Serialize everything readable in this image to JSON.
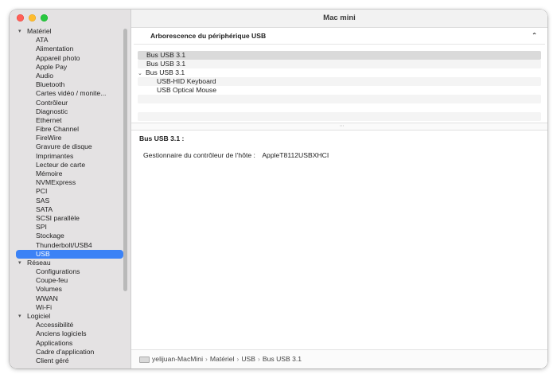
{
  "window": {
    "title": "Mac mini"
  },
  "sidebar": {
    "categories": [
      {
        "label": "Matériel",
        "items": [
          "ATA",
          "Alimentation",
          "Appareil photo",
          "Apple Pay",
          "Audio",
          "Bluetooth",
          "Cartes vidéo / monite...",
          "Contrôleur",
          "Diagnostic",
          "Ethernet",
          "Fibre Channel",
          "FireWire",
          "Gravure de disque",
          "Imprimantes",
          "Lecteur de carte",
          "Mémoire",
          "NVMExpress",
          "PCI",
          "SAS",
          "SATA",
          "SCSI parallèle",
          "SPI",
          "Stockage",
          "Thunderbolt/USB4",
          "USB"
        ]
      },
      {
        "label": "Réseau",
        "items": [
          "Configurations",
          "Coupe-feu",
          "Volumes",
          "WWAN",
          "Wi-Fi"
        ]
      },
      {
        "label": "Logiciel",
        "items": [
          "Accessibilité",
          "Anciens logiciels",
          "Applications",
          "Cadre d'application",
          "Client géré"
        ]
      }
    ],
    "selected": "USB"
  },
  "tree": {
    "header": "Arborescence du périphérique USB",
    "rows": [
      {
        "label": "Bus USB 3.1",
        "level": 0,
        "expandable": false
      },
      {
        "label": "Bus USB 3.1",
        "level": 0,
        "expandable": false
      },
      {
        "label": "Bus USB 3.1",
        "level": 0,
        "expandable": true
      },
      {
        "label": "USB-HID Keyboard",
        "level": 1,
        "expandable": false
      },
      {
        "label": "USB Optical Mouse",
        "level": 1,
        "expandable": false
      }
    ]
  },
  "detail": {
    "title": "Bus USB 3.1 :",
    "field_label": "Gestionnaire du contrôleur de l’hôte :",
    "field_value": "AppleT8112USBXHCI"
  },
  "pathbar": {
    "items": [
      "yelijuan-MacMini",
      "Matériel",
      "USB",
      "Bus USB 3.1"
    ]
  }
}
